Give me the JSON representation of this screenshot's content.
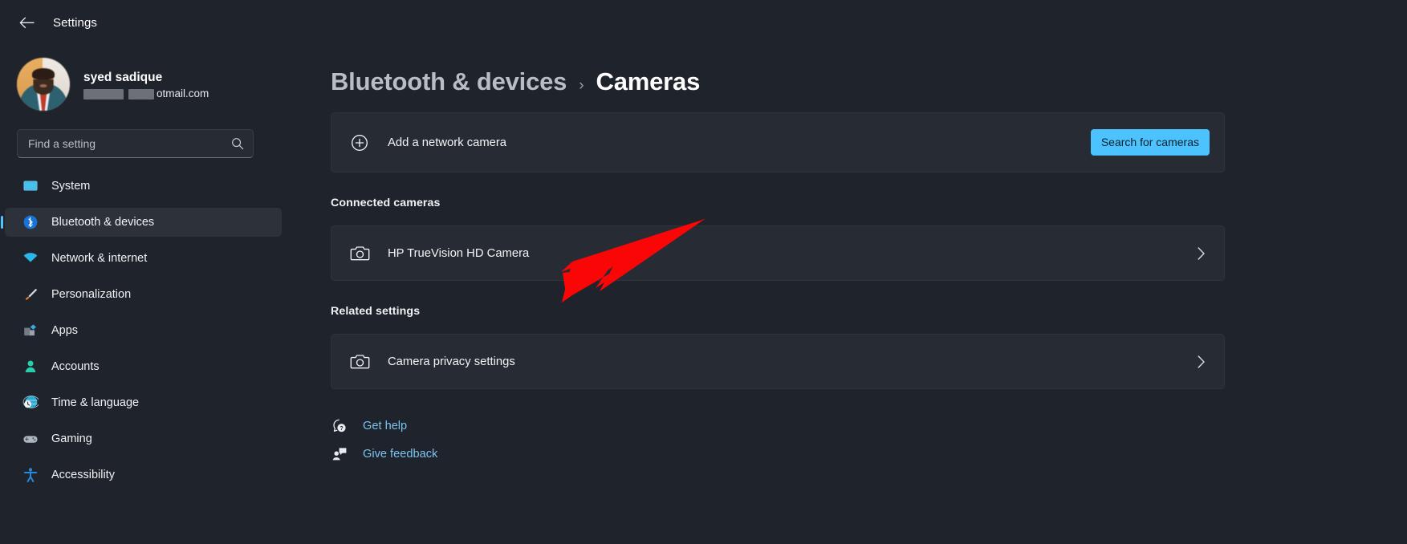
{
  "window": {
    "title": "Settings",
    "back_icon": "back-arrow-icon"
  },
  "account": {
    "name": "syed sadique",
    "email_visible_suffix": "otmail.com",
    "avatar_alt": "user-avatar"
  },
  "search": {
    "placeholder": "Find a setting",
    "value": "",
    "icon": "search-icon"
  },
  "sidebar": {
    "items": [
      {
        "label": "System",
        "icon": "display-icon",
        "active": false
      },
      {
        "label": "Bluetooth & devices",
        "icon": "bluetooth-icon",
        "active": true
      },
      {
        "label": "Network & internet",
        "icon": "wifi-icon",
        "active": false
      },
      {
        "label": "Personalization",
        "icon": "paintbrush-icon",
        "active": false
      },
      {
        "label": "Apps",
        "icon": "apps-icon",
        "active": false
      },
      {
        "label": "Accounts",
        "icon": "person-icon",
        "active": false
      },
      {
        "label": "Time & language",
        "icon": "clock-globe-icon",
        "active": false
      },
      {
        "label": "Gaming",
        "icon": "gamepad-icon",
        "active": false
      },
      {
        "label": "Accessibility",
        "icon": "accessibility-icon",
        "active": false
      }
    ]
  },
  "breadcrumb": {
    "parent": "Bluetooth & devices",
    "separator": "›",
    "current": "Cameras"
  },
  "add_camera": {
    "label": "Add a network camera",
    "icon": "plus-circle-icon",
    "button_label": "Search for cameras"
  },
  "connected": {
    "section_title": "Connected cameras",
    "cameras": [
      {
        "label": "HP TrueVision HD Camera",
        "icon": "camera-icon",
        "chevron": "chevron-right-icon"
      }
    ]
  },
  "related": {
    "section_title": "Related settings",
    "items": [
      {
        "label": "Camera privacy settings",
        "icon": "camera-icon",
        "chevron": "chevron-right-icon"
      }
    ]
  },
  "footer_links": [
    {
      "label": "Get help",
      "icon": "help-icon"
    },
    {
      "label": "Give feedback",
      "icon": "feedback-icon"
    }
  ],
  "annotation": {
    "type": "arrow",
    "color": "#fb0606",
    "points_at": "HP TrueVision HD Camera"
  },
  "colors": {
    "page_bg": "#1f232b",
    "card_bg": "#272c34",
    "accent": "#4cc2ff",
    "link": "#7cc3ef",
    "active_nav_bg": "#2c313a"
  }
}
